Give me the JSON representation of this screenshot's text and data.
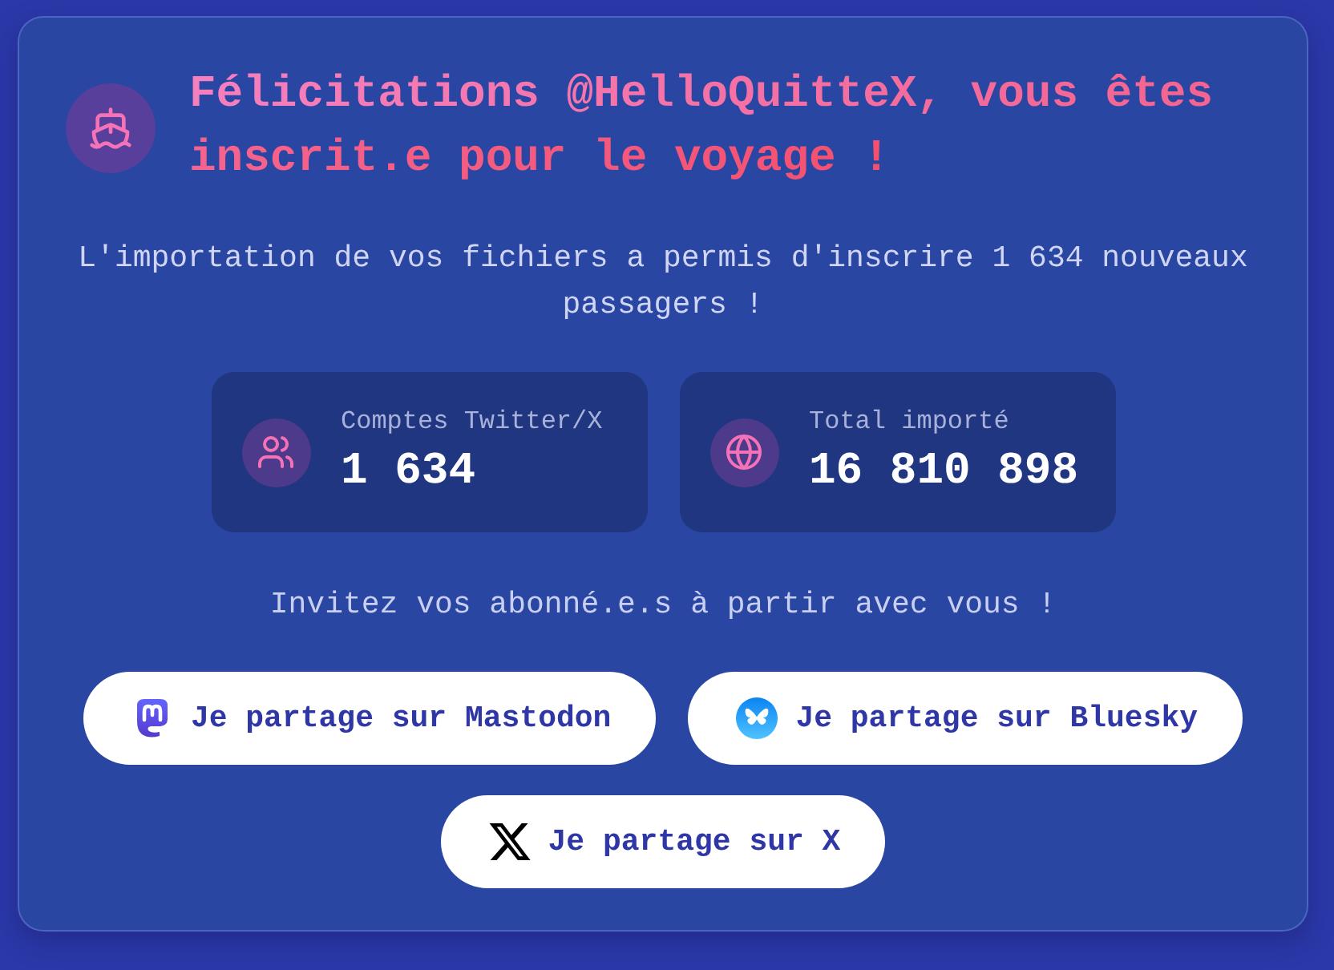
{
  "header": {
    "title": "Félicitations @HelloQuitteX, vous êtes inscrit.e pour le voyage !"
  },
  "message": "L'importation de vos fichiers a permis d'inscrire 1 634 nouveaux passagers !",
  "stats": [
    {
      "kind": "users",
      "label": "Comptes Twitter/X",
      "value": "1 634"
    },
    {
      "kind": "globe",
      "label": "Total importé",
      "value": "16 810 898"
    }
  ],
  "invite": "Invitez vos abonné.e.s à partir avec vous !",
  "share_buttons": [
    {
      "kind": "mastodon",
      "label": "Je partage sur Mastodon"
    },
    {
      "kind": "bluesky",
      "label": "Je partage sur Bluesky"
    },
    {
      "kind": "x",
      "label": "Je partage sur X"
    }
  ]
}
